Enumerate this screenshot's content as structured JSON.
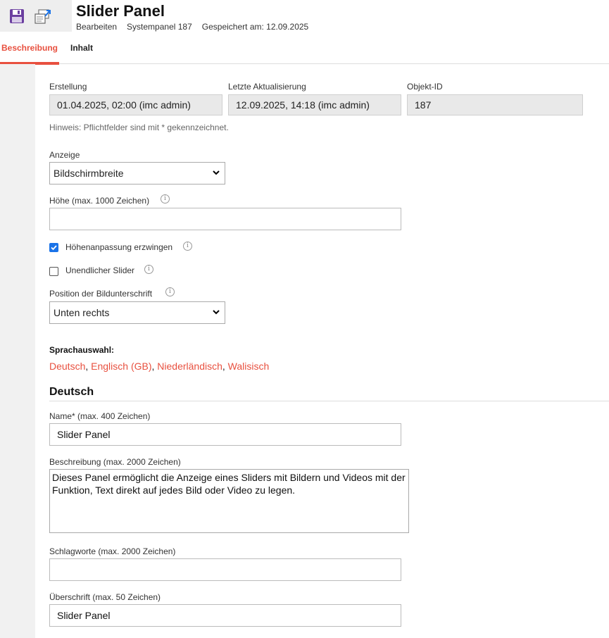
{
  "header": {
    "title": "Slider Panel",
    "meta": [
      "Bearbeiten",
      "Systempanel 187",
      "Gespeichert am: 12.09.2025"
    ]
  },
  "toolbar": {
    "icons": [
      "save-icon",
      "export-icon"
    ]
  },
  "tabs": [
    {
      "label": "Beschreibung",
      "active": true
    },
    {
      "label": "Inhalt",
      "active": false
    }
  ],
  "info_fields": [
    {
      "label": "Erstellung",
      "value": "01.04.2025, 02:00 (imc admin)"
    },
    {
      "label": "Letzte Aktualisierung",
      "value": "12.09.2025, 14:18 (imc admin)"
    },
    {
      "label": "Objekt-ID",
      "value": "187"
    }
  ],
  "hint": "Hinweis: Pflichtfelder sind mit * gekennzeichnet.",
  "anzeige": {
    "label": "Anzeige",
    "value": "Bildschirmbreite"
  },
  "hoehe": {
    "label": "Höhe (max. 1000 Zeichen)",
    "value": ""
  },
  "checkboxes": [
    {
      "label": "Höhenanpassung erzwingen",
      "checked": true
    },
    {
      "label": "Unendlicher Slider",
      "checked": false
    }
  ],
  "position": {
    "label": "Position der Bildunterschrift",
    "value": "Unten rechts"
  },
  "sprachauswahl": {
    "label": "Sprachauswahl:",
    "languages": [
      "Deutsch",
      "Englisch (GB)",
      "Niederländisch",
      "Walisisch"
    ]
  },
  "section_title": "Deutsch",
  "name": {
    "label": "Name* (max. 400 Zeichen)",
    "value": "Slider Panel"
  },
  "beschreibung": {
    "label": "Beschreibung (max. 2000 Zeichen)",
    "value": "Dieses Panel ermöglicht die Anzeige eines Sliders mit Bildern und Videos mit der Funktion, Text direkt auf jedes Bild oder Video zu legen."
  },
  "schlagworte": {
    "label": "Schlagworte (max. 2000 Zeichen)",
    "value": ""
  },
  "ueberschrift": {
    "label": "Überschrift (max. 50 Zeichen)",
    "value": "Slider Panel"
  },
  "colors": {
    "accent": "#e8503f",
    "checkbox": "#1a73e8",
    "toolbar_icon": "#6b3fa0"
  }
}
